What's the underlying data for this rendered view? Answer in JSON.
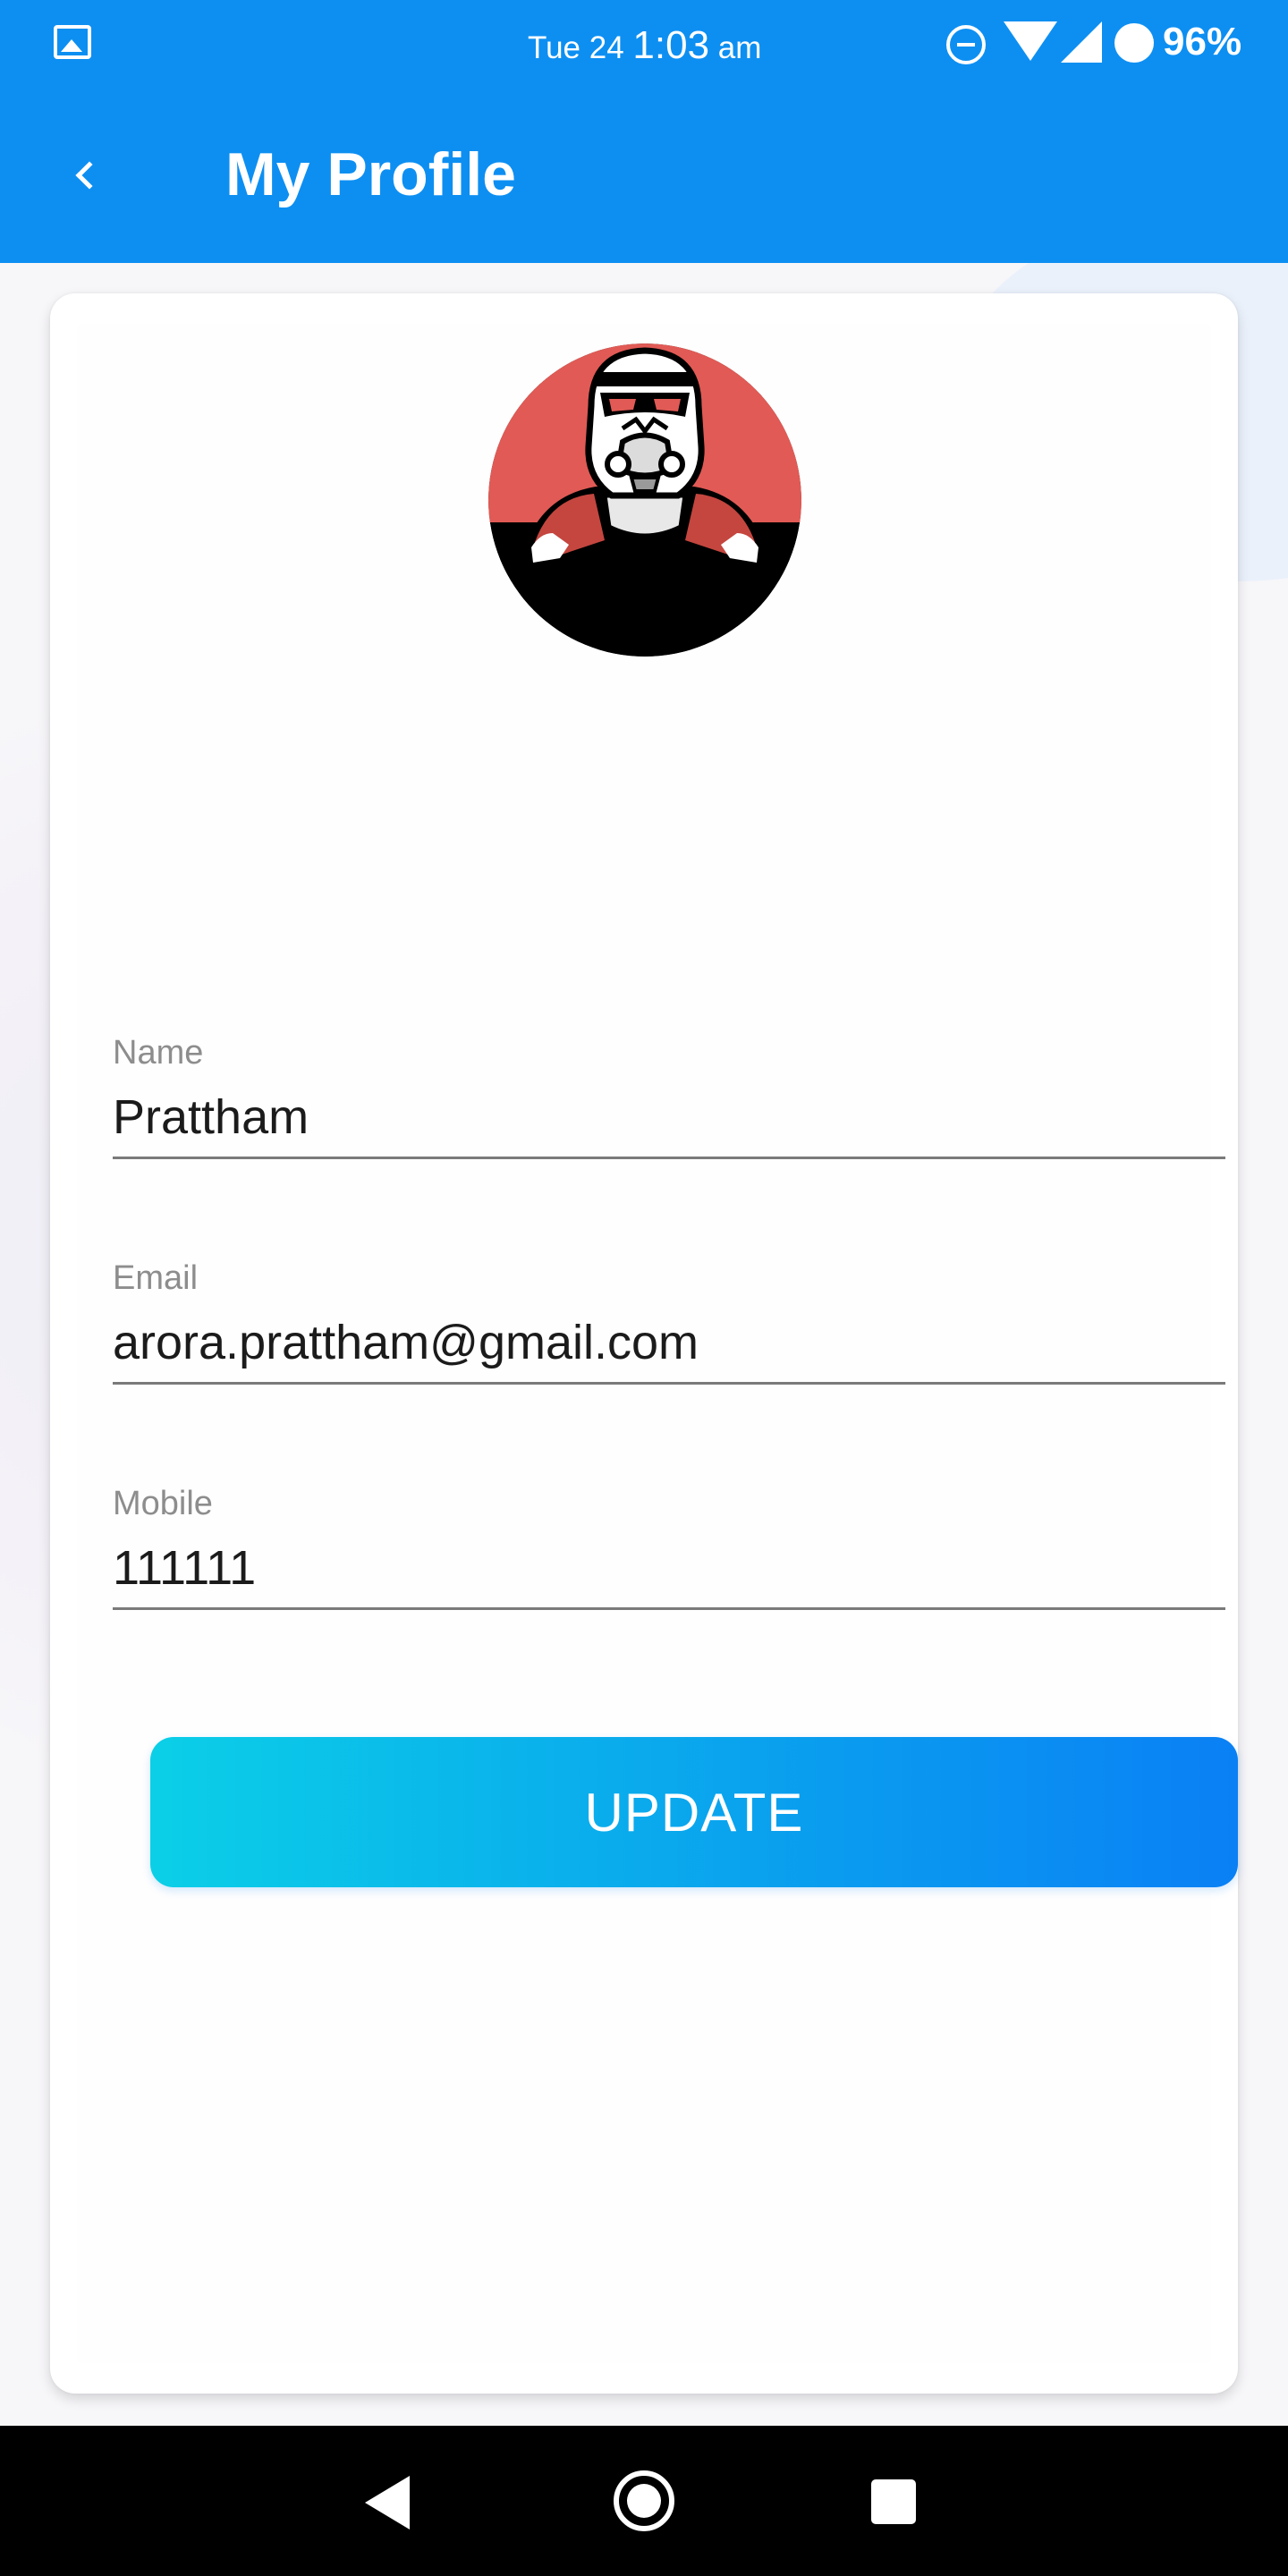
{
  "status_bar": {
    "day": "Tue 24",
    "time": "1:03",
    "ampm": "am",
    "battery": "96%",
    "icons": [
      "gallery-icon",
      "dnd-icon",
      "wifi-icon",
      "signal-icon",
      "battery-icon"
    ]
  },
  "header": {
    "title": "My Profile",
    "back_icon": "chevron-left-icon"
  },
  "form": {
    "name_label": "Name",
    "name_value": "Prattham",
    "email_label": "Email",
    "email_value": "arora.prattham@gmail.com",
    "mobile_label": "Mobile",
    "mobile_value": "111111",
    "submit_label": "UPDATE"
  },
  "colors": {
    "primary": "#0d8ff2",
    "button_gradient_start": "#0bcfe7",
    "button_gradient_end": "#0a80f5",
    "avatar_bg": "#e15a55"
  },
  "nav_bar": {
    "icons": [
      "nav-back-icon",
      "nav-home-icon",
      "nav-recents-icon"
    ]
  }
}
